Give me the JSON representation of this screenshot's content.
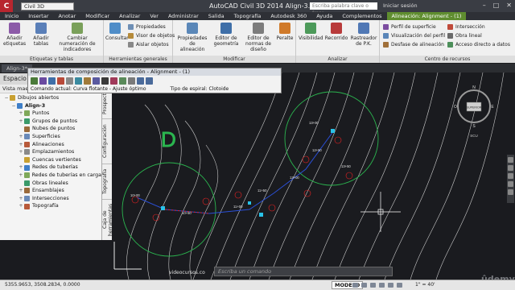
{
  "titlebar": {
    "workspace": "Civil 3D",
    "title": "AutoCAD Civil 3D 2014    Align-3.dwg",
    "search_placeholder": "Escriba palabra clave o frase",
    "user": "Iniciar sesión"
  },
  "ribbon_tabs": [
    "Inicio",
    "Insertar",
    "Anotar",
    "Modificar",
    "Analizar",
    "Ver",
    "Administrar",
    "Salida",
    "Topografía",
    "Autodesk 360",
    "Ayuda",
    "Complementos",
    "Alineación: Alignment - (1)"
  ],
  "ribbon": {
    "labels": {
      "labels_panel": "Etiquetas y tablas",
      "general_panel": "Herramientas generales",
      "modify_panel": "Modificar",
      "analyze_panel": "Analizar",
      "resources_panel": "Centro de recursos"
    },
    "buttons": {
      "add_labels": "Añadir etiquetas",
      "add_tables": "Añadir tablas",
      "renumber": "Cambiar numeración de indicadores",
      "query": "Consultar",
      "properties": "Propiedades",
      "object_viewer": "Visor de objetos",
      "isolate": "Aislar objetos",
      "alignment_props": "Propiedades de alineación",
      "geometry_editor": "Editor de geometría",
      "design_editor": "Editor de normas de diseño",
      "profile": "Peralte",
      "visibility": "Visibilidad",
      "route": "Recorrido",
      "pk_tracker": "Rastreador de P.K.",
      "surface_profile": "Perfil de superficie",
      "profile_view": "Visualización del perfil",
      "offset": "Desfase de alineación",
      "intersection": "Intersección",
      "linear_work": "Obra lineal",
      "direct_access": "Acceso directo a datos"
    }
  },
  "file_tabs": [
    "Align-3*"
  ],
  "left_panel": {
    "header": "Espacio de herramientas",
    "view": "Vista maestra",
    "tree": [
      {
        "label": "Dibujos abiertos",
        "level": 0,
        "toggle": "−"
      },
      {
        "label": "Align-3",
        "level": 1,
        "toggle": "−",
        "bold": true
      },
      {
        "label": "Puntos",
        "level": 2,
        "toggle": "+"
      },
      {
        "label": "Grupos de puntos",
        "level": 2,
        "toggle": "+"
      },
      {
        "label": "Nubes de puntos",
        "level": 2,
        "toggle": ""
      },
      {
        "label": "Superficies",
        "level": 2,
        "toggle": "+"
      },
      {
        "label": "Alineaciones",
        "level": 2,
        "toggle": "+"
      },
      {
        "label": "Emplazamientos",
        "level": 2,
        "toggle": "+"
      },
      {
        "label": "Cuencas vertientes",
        "level": 2,
        "toggle": ""
      },
      {
        "label": "Redes de tuberías",
        "level": 2,
        "toggle": "+"
      },
      {
        "label": "Redes de tuberías en carga",
        "level": 2,
        "toggle": "+"
      },
      {
        "label": "Obras lineales",
        "level": 2,
        "toggle": ""
      },
      {
        "label": "Ensamblajes",
        "level": 2,
        "toggle": "+"
      },
      {
        "label": "Intersecciones",
        "level": 2,
        "toggle": "+"
      },
      {
        "label": "Topografía",
        "level": 2,
        "toggle": "+"
      }
    ],
    "side_tabs": [
      "Prospector",
      "Configuración",
      "Topografía",
      "Caja de herramientas"
    ]
  },
  "align_toolbar": {
    "title": "Herramientas de composición de alineación - Alignment - (1)",
    "command": "Comando actual: Curva flotante - Ajuste óptimo",
    "spiral": "Tipo de espiral: Clotoide"
  },
  "canvas": {
    "compass": "SUPERIOR",
    "cardinal": [
      "N",
      "E",
      "S",
      "O"
    ],
    "wcs": "SCU",
    "command_placeholder": "Escriba un comando",
    "watermark": "videocursos.co",
    "brand": "ûdemy",
    "station_labels": [
      "10+00",
      "10+50",
      "11+00",
      "11+50",
      "12+00",
      "12+50",
      "13+00",
      "13+50",
      "14+00",
      "14+50",
      "15+00",
      "15+50",
      "16+00"
    ]
  },
  "status": {
    "coords": "5355.9653, 3508.2834, 0.0000",
    "mode": "MODELO",
    "scale": "1\" = 40'"
  },
  "colors": {
    "accent": "#5f8d2f",
    "titlebar": "#3a3d44",
    "canvas": "#1a1b1f",
    "contour": "#c9c9c9",
    "circle": "#2bb54f",
    "alignment": "#2a4fd6"
  }
}
